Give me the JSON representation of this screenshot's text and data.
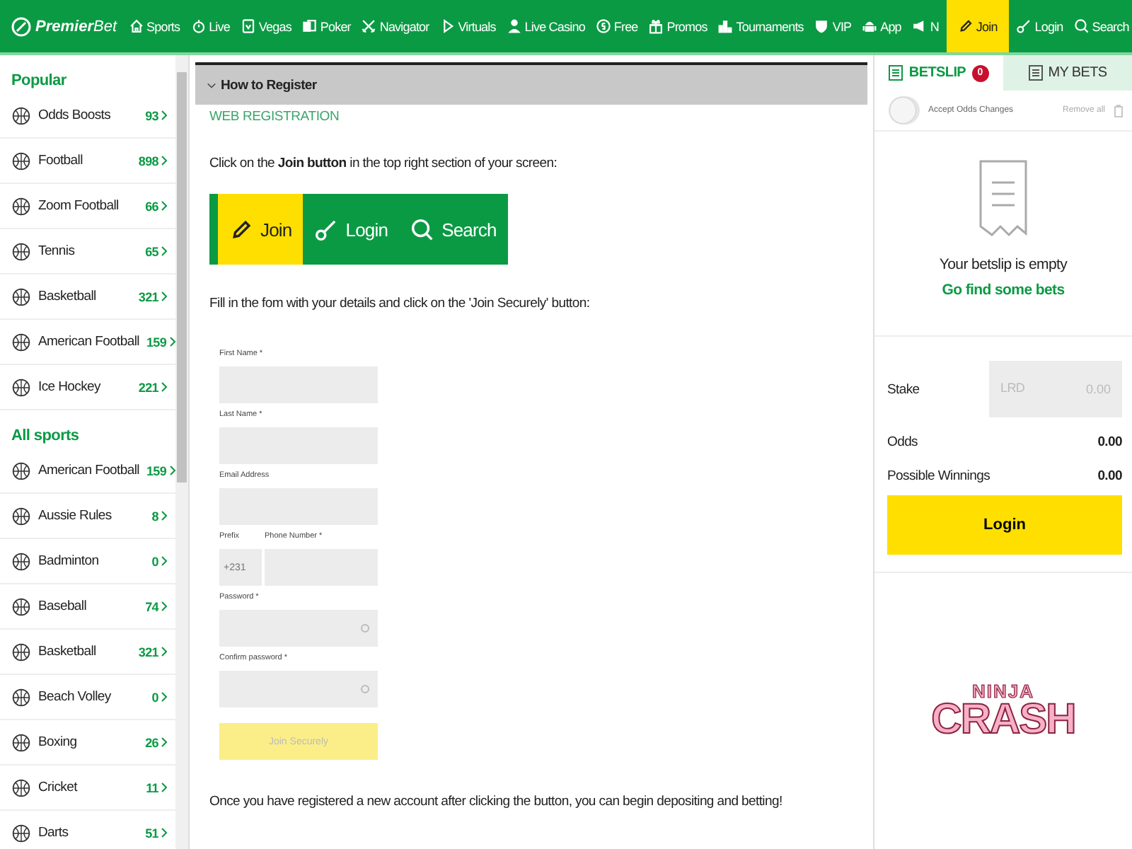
{
  "header": {
    "logo": "**Premier**Bet",
    "nav": [
      {
        "label": "Sports",
        "selected": false
      },
      {
        "label": "Live",
        "selected": false
      },
      {
        "label": "Vegas",
        "selected": false
      },
      {
        "label": "Poker",
        "selected": false
      },
      {
        "label": "Navigator",
        "selected": false
      },
      {
        "label": "Virtuals",
        "selected": false
      },
      {
        "label": "Live Casino",
        "selected": false
      },
      {
        "label": "Free",
        "selected": false
      },
      {
        "label": "Promos",
        "selected": false
      },
      {
        "label": "Tournaments",
        "selected": false
      },
      {
        "label": "VIP",
        "selected": false
      },
      {
        "label": "App",
        "selected": false
      },
      {
        "label": "N",
        "selected": false
      },
      {
        "label": "Join",
        "selected": true
      },
      {
        "label": "Login",
        "selected": false
      },
      {
        "label": "Search",
        "selected": false
      }
    ]
  },
  "sidebar": {
    "sections": [
      {
        "title": "Popular",
        "items": [
          {
            "name": "Odds Boosts",
            "count": "93"
          },
          {
            "name": "Football",
            "count": "898"
          },
          {
            "name": "Zoom Football",
            "count": "66"
          },
          {
            "name": "Tennis",
            "count": "65"
          },
          {
            "name": "Basketball",
            "count": "321"
          },
          {
            "name": "American Football",
            "count": "159"
          },
          {
            "name": "Ice Hockey",
            "count": "221"
          }
        ]
      },
      {
        "title": "All sports",
        "items": [
          {
            "name": "American Football",
            "count": "159"
          },
          {
            "name": "Aussie Rules",
            "count": "8"
          },
          {
            "name": "Badminton",
            "count": "0"
          },
          {
            "name": "Baseball",
            "count": "74"
          },
          {
            "name": "Basketball",
            "count": "321"
          },
          {
            "name": "Beach Volley",
            "count": "0"
          },
          {
            "name": "Boxing",
            "count": "26"
          },
          {
            "name": "Cricket",
            "count": "11"
          },
          {
            "name": "Darts",
            "count": "51"
          }
        ]
      }
    ]
  },
  "article": {
    "section_title": "How to Register",
    "expanded": true,
    "heading": "WEB REGISTRATION",
    "step_1": "Click on the **Join button** in the top right section of your screen:",
    "demo_buttons": [
      {
        "label": "Join",
        "selected": true
      },
      {
        "label": "Login",
        "selected": false
      },
      {
        "label": "Search",
        "selected": false
      }
    ],
    "step_2": "Fill in the fom with your details and click on the 'Join Securely' button:",
    "form": {
      "fields": [
        {
          "kind": "text",
          "label": "First Name *"
        },
        {
          "kind": "text",
          "label": "Last Name *"
        },
        {
          "kind": "text",
          "label": "Email Address"
        },
        {
          "kind": "phone",
          "prefix_label": "Prefix",
          "prefix_placeholder": "+231",
          "label": "Phone Number *"
        },
        {
          "kind": "password",
          "label": "Password *"
        },
        {
          "kind": "password",
          "label": "Confirm password *"
        }
      ],
      "submit": {
        "label": "Join Securely",
        "disabled": true
      }
    },
    "step_3": "Once you have registered a new account after clicking the button, you can begin depositing and betting!"
  },
  "betslip": {
    "tabs": [
      {
        "label": "BETSLIP",
        "badge": "0",
        "selected": true
      },
      {
        "label": "MY BETS",
        "selected": false
      }
    ],
    "accept_odds": {
      "label": "Accept Odds Changes",
      "on": false
    },
    "remove_all": "Remove all",
    "empty_title": "Your betslip is empty",
    "empty_link": "Go find some bets",
    "stake": {
      "label": "Stake",
      "currency": "LRD",
      "placeholder": "0.00"
    },
    "odds": {
      "label": "Odds",
      "value": "0.00"
    },
    "winnings": {
      "label": "Possible Winnings",
      "value": "0.00"
    },
    "login": "Login",
    "banner": {
      "line_1": "NINJA",
      "line_2": "CRASH"
    }
  }
}
